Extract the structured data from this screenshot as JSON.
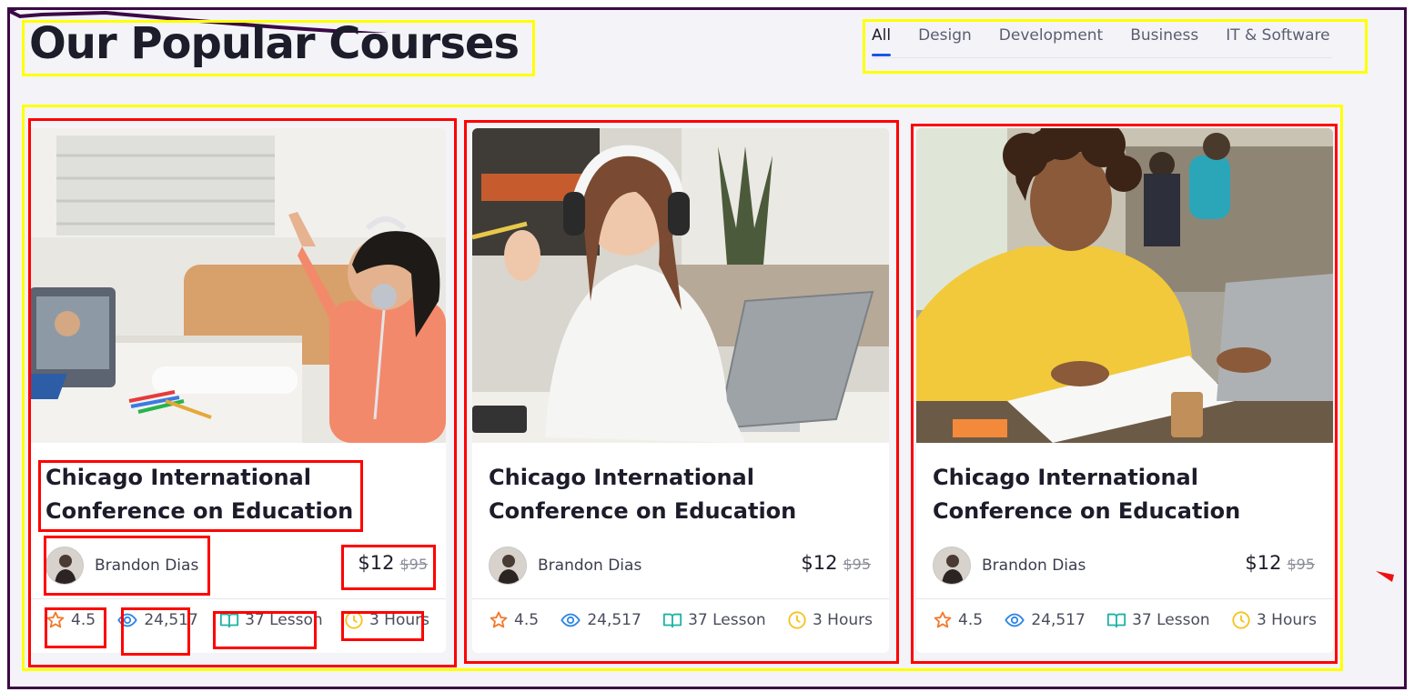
{
  "section": {
    "title": "Our Popular Courses"
  },
  "tabs": [
    {
      "label": "All",
      "active": true
    },
    {
      "label": "Design",
      "active": false
    },
    {
      "label": "Development",
      "active": false
    },
    {
      "label": "Business",
      "active": false
    },
    {
      "label": "IT & Software",
      "active": false
    }
  ],
  "courses": [
    {
      "title": "Chicago International Conference on Education",
      "image": "girl-with-headphones-raising-hand-photo",
      "author": "Brandon Dias",
      "price": "$12",
      "old_price": "$95",
      "rating": "4.5",
      "views": "24,517",
      "lessons": "37 Lesson",
      "duration": "3 Hours"
    },
    {
      "title": "Chicago International Conference on Education",
      "image": "woman-with-headphones-laptop-photo",
      "author": "Brandon Dias",
      "price": "$12",
      "old_price": "$95",
      "rating": "4.5",
      "views": "24,517",
      "lessons": "37 Lesson",
      "duration": "3 Hours"
    },
    {
      "title": "Chicago International Conference on Education",
      "image": "man-in-yellow-shirt-laptop-cafe-photo",
      "author": "Brandon Dias",
      "price": "$12",
      "old_price": "$95",
      "rating": "4.5",
      "views": "24,517",
      "lessons": "37 Lesson",
      "duration": "3 Hours"
    }
  ],
  "icons": {
    "rating": "star-icon",
    "views": "eye-icon",
    "lessons": "book-icon",
    "duration": "clock-icon"
  },
  "colors": {
    "accent": "#1a56e6",
    "star": "#f37a2c",
    "eye": "#2f86e6",
    "book": "#1db3a4",
    "clock": "#f6c31b",
    "annotation_yellow": "#ffff00",
    "annotation_red": "#ff0000",
    "frame": "#3b0a45"
  }
}
